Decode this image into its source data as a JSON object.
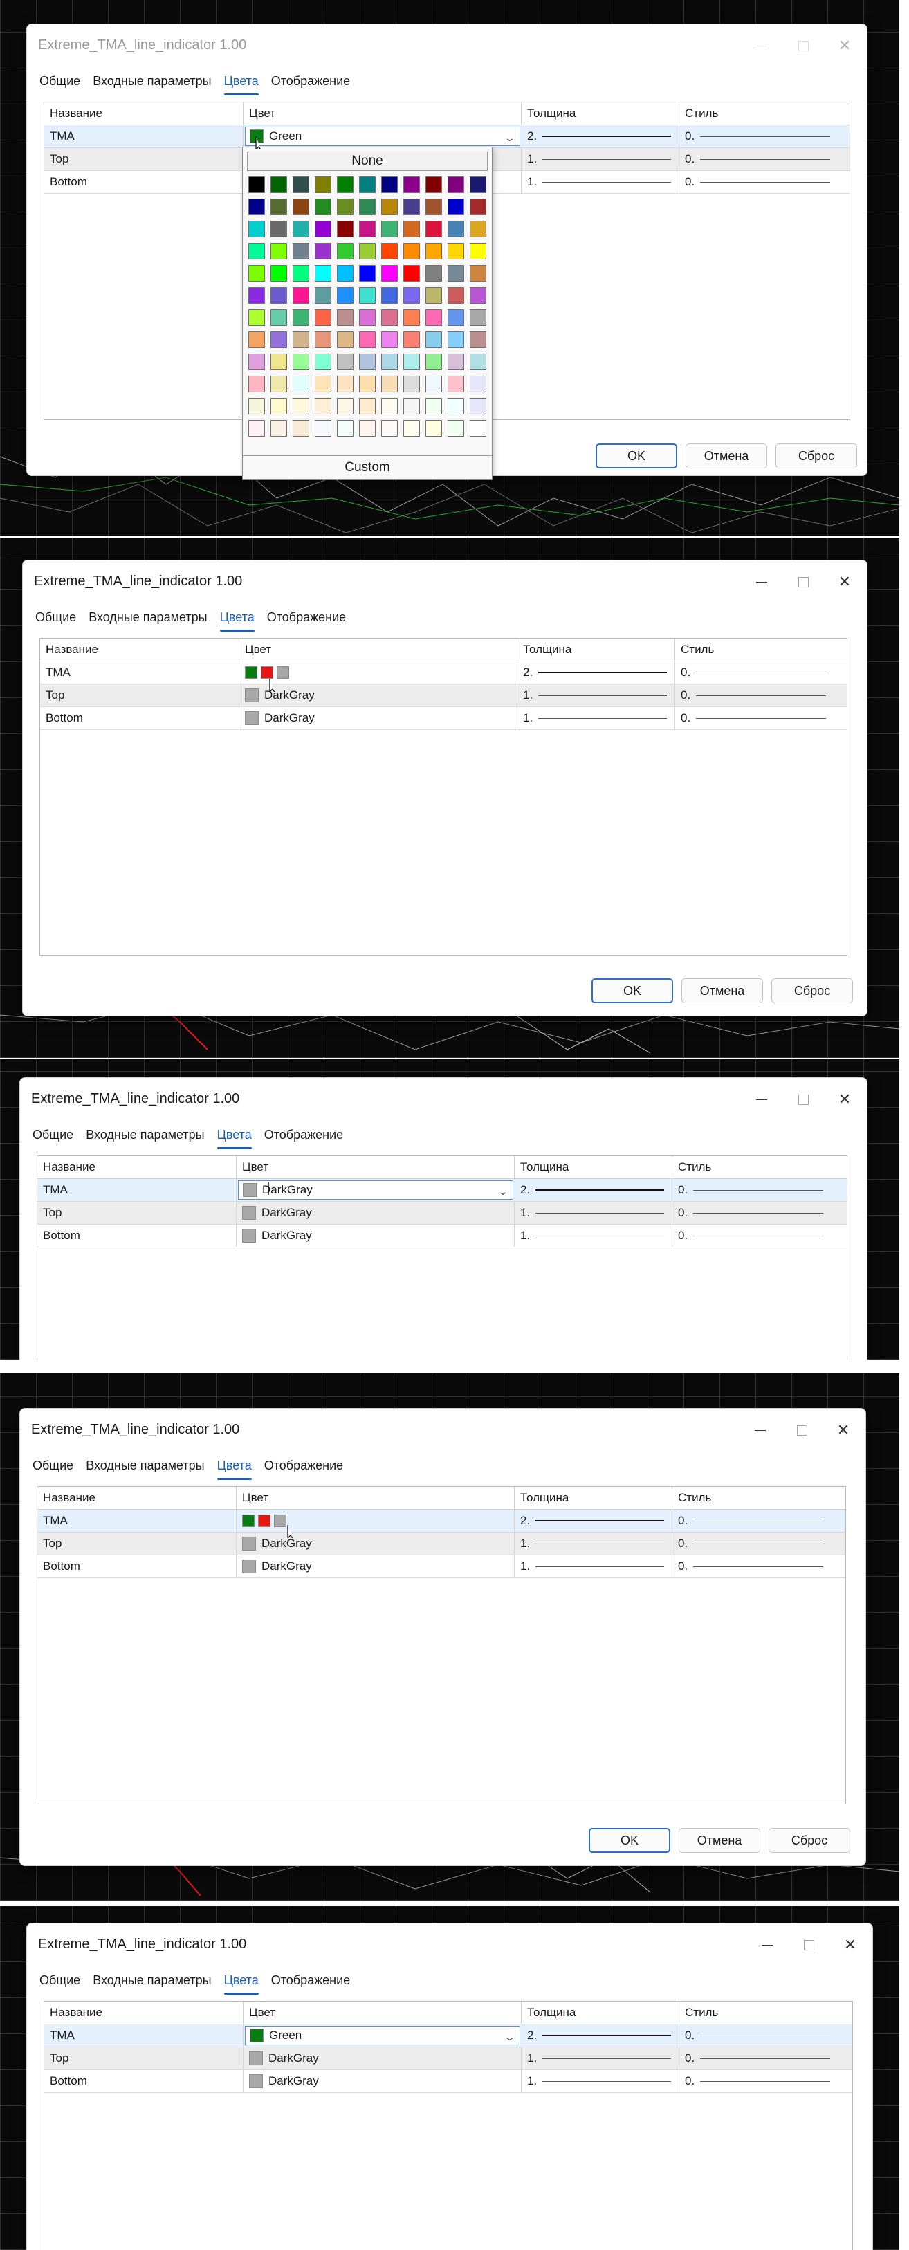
{
  "colors": {
    "accent": "#1a5fb4",
    "green": "#0a7d12",
    "red": "#e41717",
    "darkgray": "#a9a9a9",
    "selected_row": "#e4f0fb"
  },
  "dialog": {
    "title": "Extreme_TMA_line_indicator 1.00",
    "tabs": [
      "Общие",
      "Входные параметры",
      "Цвета",
      "Отображение"
    ],
    "active_tab": "Цвета",
    "columns": {
      "name": "Название",
      "color": "Цвет",
      "width": "Толщина",
      "style": "Стиль"
    },
    "buttons": {
      "ok": "OK",
      "cancel": "Отмена",
      "reset": "Сброс"
    },
    "rows": [
      {
        "name": "TMA",
        "color": "Green",
        "width": "2.",
        "style": "0."
      },
      {
        "name": "Top",
        "color": "DarkGray",
        "width": "1.",
        "style": "0."
      },
      {
        "name": "Bottom",
        "color": "DarkGray",
        "width": "1.",
        "style": "0."
      }
    ]
  },
  "panels": [
    {
      "label": "color-dropdown-open",
      "tma_color": "Green",
      "popup": {
        "none_label": "None",
        "custom_label": "Custom"
      }
    },
    {
      "label": "quick-swatches",
      "tma_swatches": [
        "#0a7d12",
        "#e41717",
        "#a9a9a9"
      ]
    },
    {
      "label": "darkgray-selected",
      "tma_color": "DarkGray"
    },
    {
      "label": "quick-swatches-2",
      "tma_swatches": [
        "#0a7d12",
        "#e41717",
        "#a9a9a9"
      ]
    },
    {
      "label": "green-selected",
      "tma_color": "Green"
    }
  ],
  "palette": [
    "#000000",
    "#006400",
    "#2f4f4f",
    "#808000",
    "#008000",
    "#008080",
    "#000080",
    "#8b008b",
    "#800000",
    "#800080",
    "#191970",
    "#00008b",
    "#556b2f",
    "#8b4513",
    "#228b22",
    "#6b8e23",
    "#2e8b57",
    "#b8860b",
    "#483d8b",
    "#a0522d",
    "#0000cd",
    "#a52a2a",
    "#00ced1",
    "#696969",
    "#20b2aa",
    "#9400d3",
    "#8b0000",
    "#c71585",
    "#3cb371",
    "#d2691e",
    "#dc143c",
    "#4682b4",
    "#daa520",
    "#00fa9a",
    "#7fff00",
    "#708090",
    "#9932cc",
    "#32cd32",
    "#9acd32",
    "#ff4500",
    "#ff8c00",
    "#ffa500",
    "#ffd700",
    "#ffff00",
    "#7cfc00",
    "#00ff00",
    "#00ff7f",
    "#00ffff",
    "#00bfff",
    "#0000ff",
    "#ff00ff",
    "#ff0000",
    "#808080",
    "#778899",
    "#cd853f",
    "#8a2be2",
    "#6a5acd",
    "#ff1493",
    "#5f9ea0",
    "#1e90ff",
    "#40e0d0",
    "#4169e1",
    "#7b68ee",
    "#bdb76b",
    "#cd5c5c",
    "#ba55d3",
    "#adff2f",
    "#66cdaa",
    "#3cb371",
    "#ff6347",
    "#bc8f8f",
    "#da70d6",
    "#db7093",
    "#ff7f50",
    "#ff69b4",
    "#6495ed",
    "#a9a9a9",
    "#f4a460",
    "#9370db",
    "#d2b48c",
    "#e9967a",
    "#deb887",
    "#ff69b4",
    "#ee82ee",
    "#fa8072",
    "#87ceeb",
    "#87cefa",
    "#bc8f8f",
    "#dda0dd",
    "#f0e68c",
    "#98fb98",
    "#7fffd4",
    "#c0c0c0",
    "#b0c4de",
    "#add8e6",
    "#afeeee",
    "#90ee90",
    "#d8bfd8",
    "#b0e0e6",
    "#ffb6c1",
    "#eee8aa",
    "#e0ffff",
    "#ffe4b5",
    "#ffe4c4",
    "#ffdead",
    "#f5deb3",
    "#dcdcdc",
    "#f0f8ff",
    "#ffc0cb",
    "#e6e6fa",
    "#f5f5dc",
    "#fffacd",
    "#fff8dc",
    "#ffefd5",
    "#fdf5e6",
    "#ffebcd",
    "#fffaf0",
    "#f5f5f5",
    "#f0fff0",
    "#f0ffff",
    "#e6e6fa",
    "#fff0f5",
    "#faf0e6",
    "#faebd7",
    "#f8f8ff",
    "#f5fffa",
    "#fff5ee",
    "#fffafa",
    "#fffff0",
    "#ffffe0",
    "#f0fff0",
    "#ffffff"
  ]
}
